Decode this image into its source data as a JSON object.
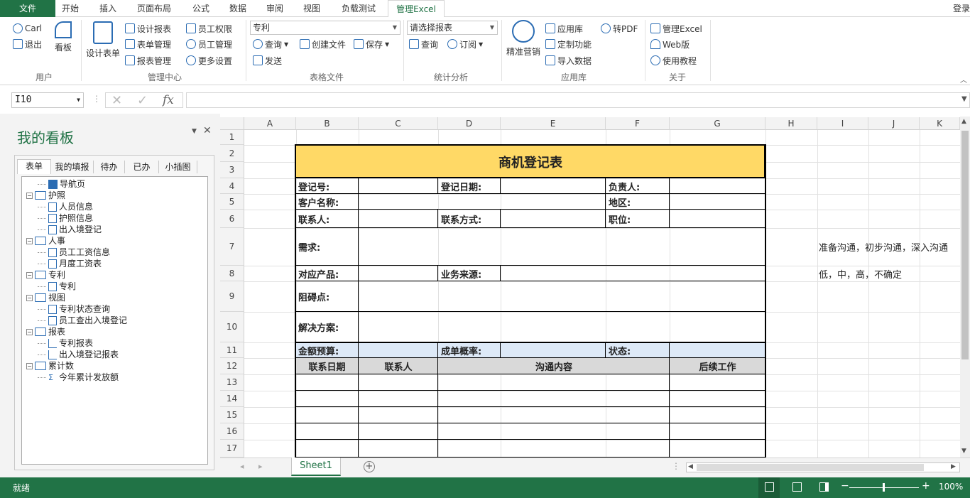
{
  "tabs": [
    "文件",
    "开始",
    "插入",
    "页面布局",
    "公式",
    "数据",
    "审阅",
    "视图",
    "负载测试",
    "管理Excel"
  ],
  "login_label": "登录",
  "ribbon": {
    "user_carl": "Carl",
    "logout": "退出",
    "kanban": "看板",
    "grp_user": "用户",
    "design_form": "设计表单",
    "design_report": "设计报表",
    "form_manage": "表单管理",
    "report_manage": "报表管理",
    "emp_perm": "员工权限",
    "emp_manage": "员工管理",
    "more_settings": "更多设置",
    "grp_mgmt": "管理中心",
    "combo_form": "专利",
    "query": "查询",
    "create_file": "创建文件",
    "save": "保存",
    "send": "发送",
    "grp_file": "表格文件",
    "combo_report": "请选择报表",
    "stat_query": "查询",
    "subscribe": "订阅",
    "grp_stat": "统计分析",
    "precise_marketing": "精准营销",
    "app_store": "应用库",
    "custom_func": "定制功能",
    "import_data": "导入数据",
    "to_pdf": "转PDF",
    "grp_app": "应用库",
    "manage_excel": "管理Excel",
    "web_version": "Web版",
    "tutorial": "使用教程",
    "grp_about": "关于"
  },
  "namebox": "I10",
  "fx": "fx",
  "panel": {
    "title": "我的看板",
    "tabs": [
      "表单",
      "我的填报",
      "待办",
      "已办",
      "小插图"
    ],
    "tree": [
      {
        "label": "导航页",
        "level": 1,
        "type": "nav"
      },
      {
        "label": "护照",
        "level": 0,
        "type": "folder"
      },
      {
        "label": "人员信息",
        "level": 1,
        "type": "doc"
      },
      {
        "label": "护照信息",
        "level": 1,
        "type": "doc"
      },
      {
        "label": "出入境登记",
        "level": 1,
        "type": "doc"
      },
      {
        "label": "人事",
        "level": 0,
        "type": "folder"
      },
      {
        "label": "员工工资信息",
        "level": 1,
        "type": "doc"
      },
      {
        "label": "月度工资表",
        "level": 1,
        "type": "doc"
      },
      {
        "label": "专利",
        "level": 0,
        "type": "folder"
      },
      {
        "label": "专利",
        "level": 1,
        "type": "doc"
      },
      {
        "label": "视图",
        "level": 0,
        "type": "folder"
      },
      {
        "label": "专利状态查询",
        "level": 1,
        "type": "view"
      },
      {
        "label": "员工查出入境登记",
        "level": 1,
        "type": "view"
      },
      {
        "label": "报表",
        "level": 0,
        "type": "folder"
      },
      {
        "label": "专利报表",
        "level": 1,
        "type": "chart"
      },
      {
        "label": "出入境登记报表",
        "level": 1,
        "type": "chart"
      },
      {
        "label": "累计数",
        "level": 0,
        "type": "folder"
      },
      {
        "label": "今年累计发放额",
        "level": 1,
        "type": "sum"
      }
    ]
  },
  "columns": [
    "A",
    "B",
    "C",
    "D",
    "E",
    "F",
    "G",
    "H",
    "I",
    "J",
    "K"
  ],
  "rows": [
    "1",
    "2",
    "3",
    "4",
    "5",
    "6",
    "7",
    "8",
    "9",
    "10",
    "11",
    "12",
    "13",
    "14",
    "15",
    "16",
    "17"
  ],
  "sheet": {
    "title": "商机登记表",
    "reg_no": "登记号:",
    "reg_date": "登记日期:",
    "owner": "负责人:",
    "customer": "客户名称:",
    "region": "地区:",
    "contact": "联系人:",
    "contact_method": "联系方式:",
    "position": "职位:",
    "demand": "需求:",
    "product": "对应产品:",
    "source": "业务来源:",
    "obstacle": "阻碍点:",
    "solution": "解决方案:",
    "budget": "金额预算:",
    "probability": "成单概率:",
    "status": "状态:",
    "h_date": "联系日期",
    "h_contact": "联系人",
    "h_content": "沟通内容",
    "h_followup": "后续工作",
    "i7": "准备沟通，初步沟通，深入沟通",
    "i8": "低，中，高，不确定"
  },
  "sheet_tab": "Sheet1",
  "status_text": "就绪",
  "zoom": "100%",
  "colors": {
    "accent": "#217346",
    "title_fill": "#ffd966",
    "band_fill": "#dde9f7",
    "header_fill": "#d9d9d9"
  }
}
